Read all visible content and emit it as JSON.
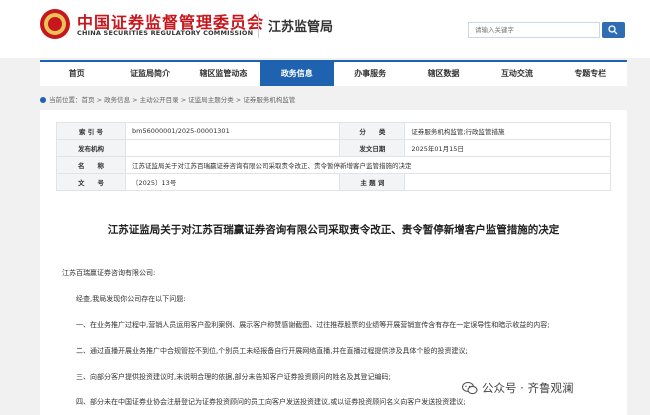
{
  "header": {
    "org_name_cn": "中国证券监督管理委员会",
    "org_name_en": "CHINA SECURITIES REGULATORY COMMISSION",
    "bureau": "江苏监管局",
    "search_placeholder": "请输入关键字",
    "search_icon": "search-icon"
  },
  "nav": {
    "items": [
      {
        "label": "首页"
      },
      {
        "label": "证监局简介"
      },
      {
        "label": "辖区监管动态"
      },
      {
        "label": "政务信息"
      },
      {
        "label": "办事服务"
      },
      {
        "label": "辖区数据"
      },
      {
        "label": "互动交流"
      },
      {
        "label": "专题专栏"
      }
    ],
    "active_label": "政务信息",
    "accent_color": "#1f63b0"
  },
  "breadcrumb": {
    "text": "当前位置：首页 > 政务信息 > 主动公开目录 > 证监局主题分类 > 证券服务机构监管"
  },
  "meta": {
    "index_label": "索 引 号",
    "index_value": "bm56000001/2025-00001301",
    "category_label": "分　　类",
    "category_value": "证券服务机构监管;行政监管措施",
    "issuer_label": "发布机构",
    "issuer_value": "",
    "date_label": "发文日期",
    "date_value": "2025年01月15日",
    "name_label": "名　　称",
    "name_value": "江苏证监局关于对江苏百瑞赢证券咨询有限公司采取责令改正、责令暂停新增客户监管措施的决定",
    "docno_label": "文　　号",
    "docno_value": "〔2025〕13号",
    "keyword_label": "主 题 词",
    "keyword_value": ""
  },
  "document": {
    "title": "江苏证监局关于对江苏百瑞赢证券咨询有限公司采取责令改正、责令暂停新增客户监管措施的决定",
    "addressee": "江苏百瑞赢证券咨询有限公司:",
    "intro": "经查,我局发现你公司存在以下问题:",
    "points": [
      "一、在业务推广过程中,营销人员运用客户盈利案例、展示客户称赞感谢截图、过往推荐股票的业绩等开展营销宣传含有存在一定误导性和暗示收益的内容;",
      "二、通过直播开展业务推广中合规管控不到位,个别员工未经报备自行开展网络直播,并在直播过程提供涉及具体个股的投资建议;",
      "三、向部分客户提供投资建议时,未说明合理的依据,部分未告知客户证券投资顾问的姓名及其登记编码;",
      "四、部分未在中国证券业协会注册登记为证券投资顾问的员工向客户发送投资建议,或以证券投资顾问名义向客户发送投资建议;"
    ]
  },
  "watermark": {
    "text": "公众号 · 齐鲁观澜",
    "icon": "wechat-icon"
  }
}
